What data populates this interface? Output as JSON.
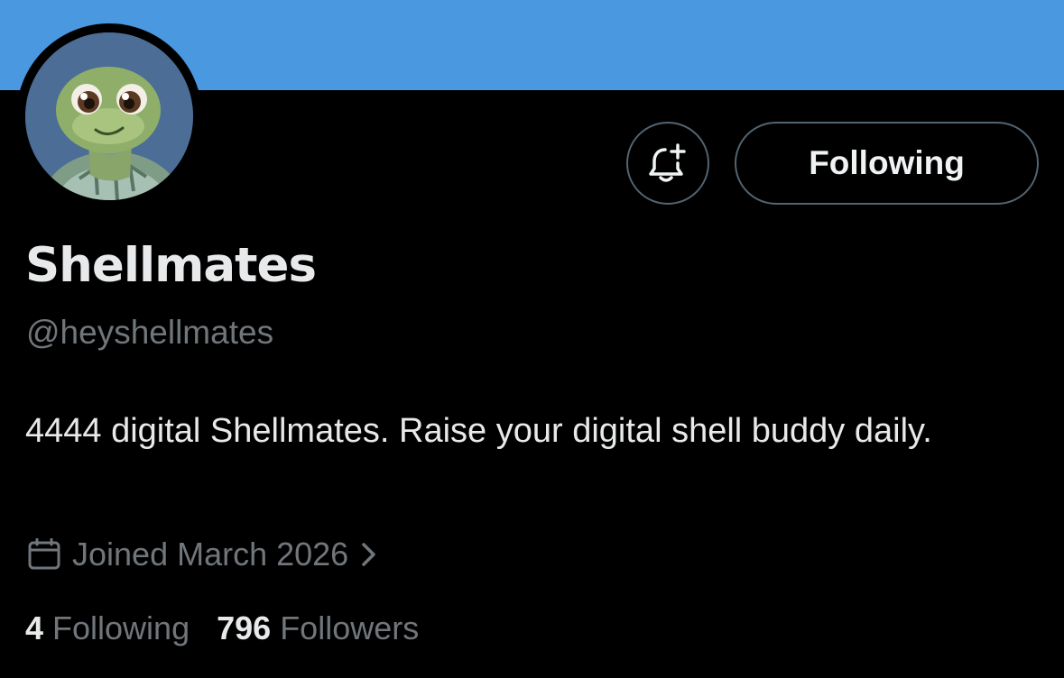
{
  "profile": {
    "display_name": "Shellmates",
    "handle": "@heyshellmates",
    "bio": "4444 digital Shellmates. Raise your digital shell buddy daily.",
    "joined": "Joined March 2026",
    "avatar_alt": "turtle-avatar"
  },
  "actions": {
    "notify_icon": "bell-plus-icon",
    "follow_label": "Following"
  },
  "stats": {
    "following_count": "4",
    "following_label": "Following",
    "followers_count": "796",
    "followers_label": "Followers"
  },
  "icons": {
    "joined_icon": "calendar-icon",
    "joined_chevron": "chevron-right-icon"
  },
  "colors": {
    "banner": "#4a98e0",
    "background": "#000000",
    "primary_text": "#e7e9ea",
    "secondary_text": "#71767b",
    "button_border": "#536471",
    "avatar_bg": "#4c6d95"
  }
}
